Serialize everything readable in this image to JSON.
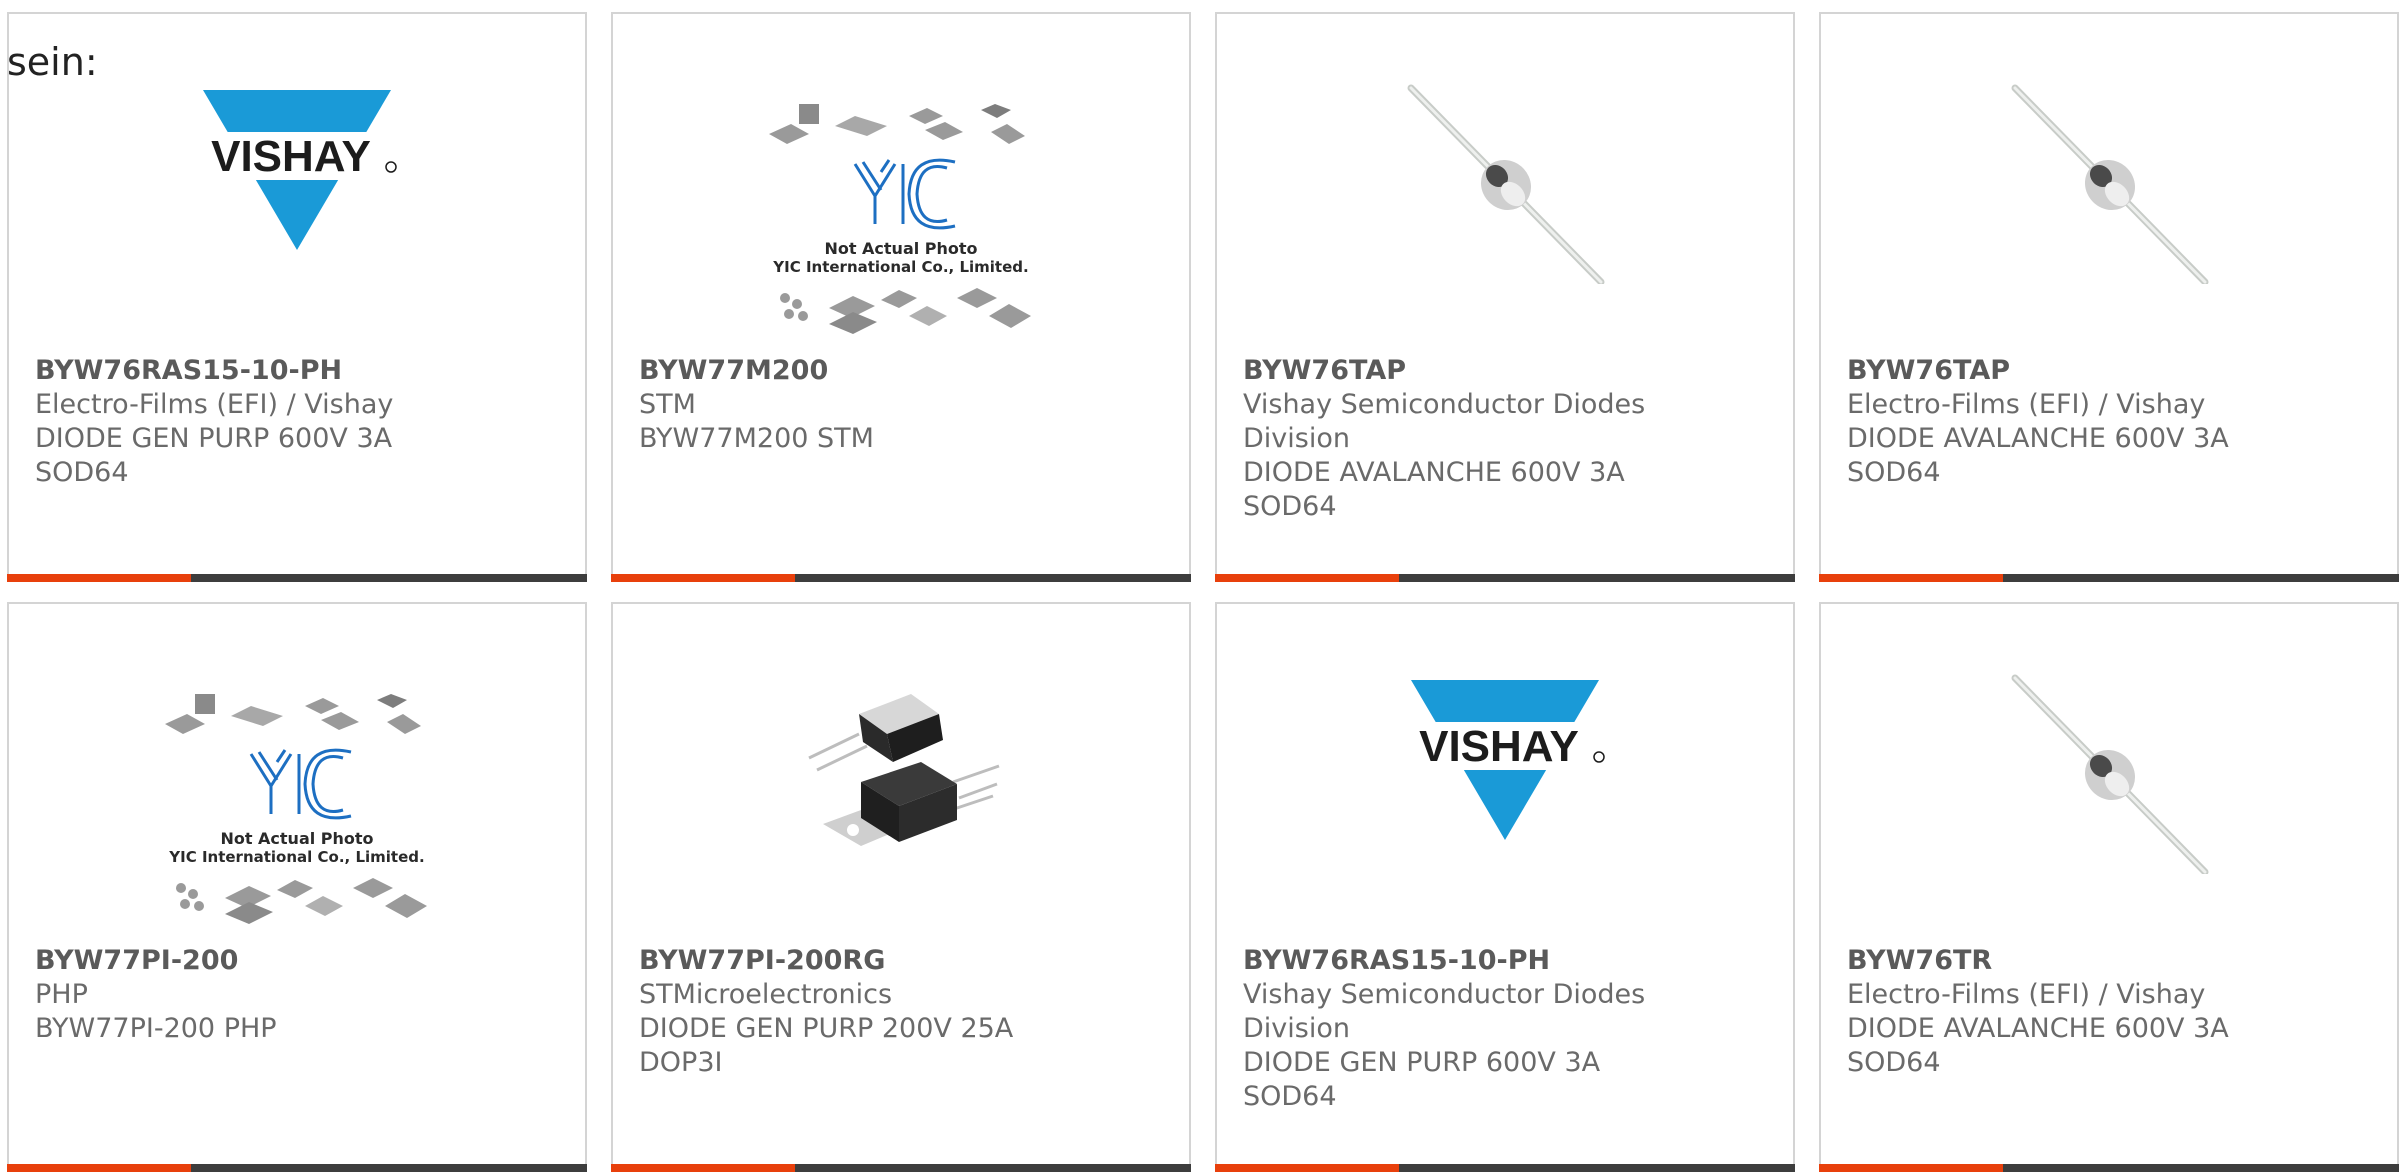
{
  "intro_text": "sein:",
  "colors": {
    "accent": "#e8400c",
    "bar_dark": "#3d3d3d",
    "vishay_blue": "#1a9ad7",
    "yic_blue": "#1d6fc2"
  },
  "products": [
    {
      "image": "vishay-logo",
      "logo_text": "VISHAY",
      "part": "BYW76RAS15-10-PH",
      "lines": [
        "Electro-Films (EFI) / Vishay",
        "DIODE GEN PURP 600V 3A",
        "SOD64"
      ]
    },
    {
      "image": "yic-placeholder",
      "logo_text": "YIC",
      "caption_1": "Not Actual Photo",
      "caption_2": "YIC International Co., Limited.",
      "part": "BYW77M200",
      "lines": [
        "STM",
        "BYW77M200 STM"
      ]
    },
    {
      "image": "axial-diode",
      "part": "BYW76TAP",
      "lines": [
        "Vishay Semiconductor Diodes",
        "Division",
        "DIODE AVALANCHE 600V 3A",
        "SOD64"
      ]
    },
    {
      "image": "axial-diode",
      "part": "BYW76TAP",
      "lines": [
        "Electro-Films (EFI) / Vishay",
        "DIODE AVALANCHE 600V 3A",
        "SOD64"
      ]
    },
    {
      "image": "yic-placeholder",
      "logo_text": "YIC",
      "caption_1": "Not Actual Photo",
      "caption_2": "YIC International Co., Limited.",
      "part": "BYW77PI-200",
      "lines": [
        "PHP",
        "BYW77PI-200 PHP"
      ]
    },
    {
      "image": "to-package",
      "part": "BYW77PI-200RG",
      "lines": [
        "STMicroelectronics",
        "DIODE GEN PURP 200V 25A",
        "DOP3I"
      ]
    },
    {
      "image": "vishay-logo",
      "logo_text": "VISHAY",
      "part": "BYW76RAS15-10-PH",
      "lines": [
        "Vishay Semiconductor Diodes",
        "Division",
        "DIODE GEN PURP 600V 3A",
        "SOD64"
      ]
    },
    {
      "image": "axial-diode",
      "part": "BYW76TR",
      "lines": [
        "Electro-Films (EFI) / Vishay",
        "DIODE AVALANCHE 600V 3A",
        "SOD64"
      ]
    }
  ]
}
